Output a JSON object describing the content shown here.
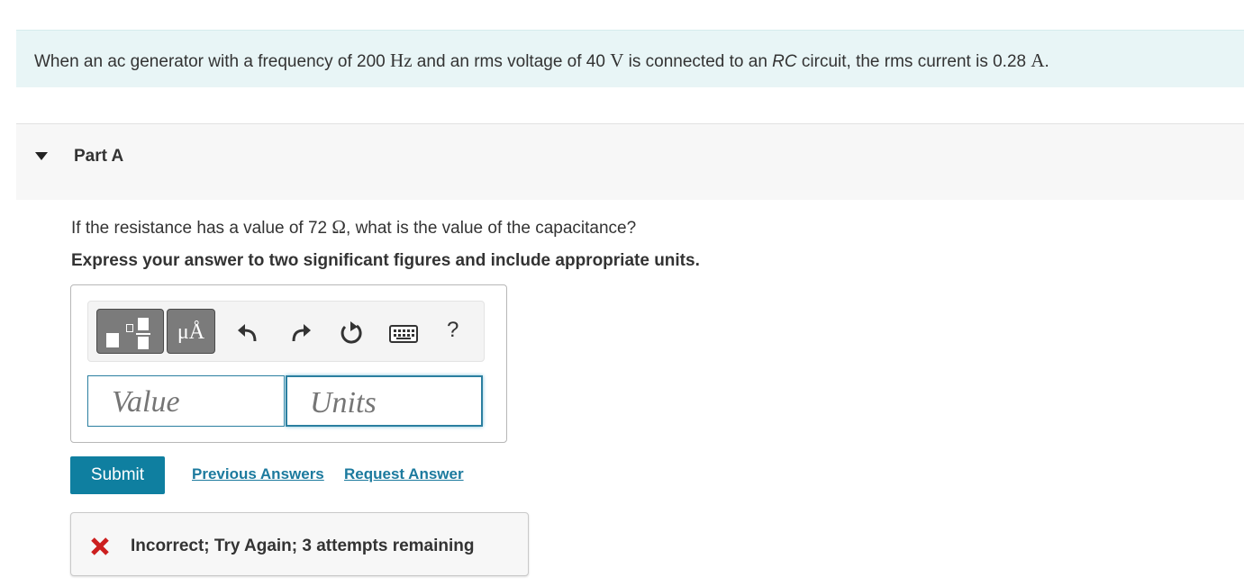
{
  "intro": {
    "text_1": "When an ac generator with a frequency of 200 ",
    "unit_hz": "Hz",
    "text_2": " and an rms voltage of 40 ",
    "unit_v": "V",
    "text_3": " is connected to an ",
    "rc": "RC",
    "text_4": " circuit, the rms current is 0.28 ",
    "unit_a": "A",
    "text_5": "."
  },
  "part": {
    "title": "Part A",
    "question_1": "If the resistance has a value of 72 ",
    "omega": "Ω",
    "question_2": ", what is the value of the capacitance?",
    "instruction": "Express your answer to two significant figures and include appropriate units."
  },
  "toolbar": {
    "units_button_label": "μÅ",
    "icons": [
      "templates-icon",
      "units-icon",
      "undo-icon",
      "redo-icon",
      "reset-icon",
      "keyboard-icon",
      "help-icon"
    ],
    "help_label": "?"
  },
  "inputs": {
    "value_placeholder": "Value",
    "units_placeholder": "Units"
  },
  "actions": {
    "submit_label": "Submit",
    "previous_answers": "Previous Answers",
    "request_answer": "Request Answer"
  },
  "feedback": {
    "message": "Incorrect; Try Again; 3 attempts remaining",
    "status_color": "#cc1f1f"
  },
  "colors": {
    "accent": "#0f7fa0",
    "link": "#1c7a9e",
    "intro_bg": "#e8f5f6"
  }
}
